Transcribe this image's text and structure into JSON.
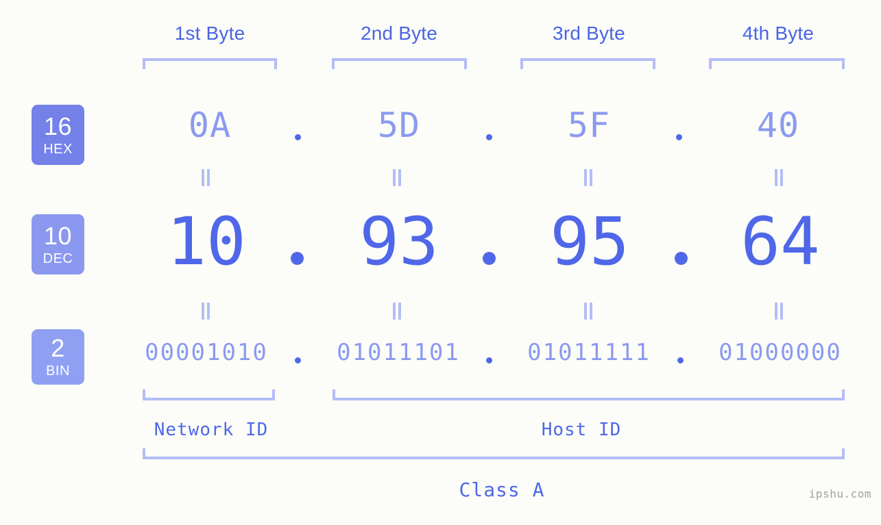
{
  "header": {
    "byte_labels": [
      "1st Byte",
      "2nd Byte",
      "3rd Byte",
      "4th Byte"
    ]
  },
  "badges": [
    {
      "num": "16",
      "sub": "HEX"
    },
    {
      "num": "10",
      "sub": "DEC"
    },
    {
      "num": "2",
      "sub": "BIN"
    }
  ],
  "rows": {
    "hex": {
      "values": [
        "0A",
        "5D",
        "5F",
        "40"
      ],
      "separator": "."
    },
    "dec": {
      "values": [
        "10",
        "93",
        "95",
        "64"
      ],
      "separator": "."
    },
    "bin": {
      "values": [
        "00001010",
        "01011101",
        "01011111",
        "01000000"
      ],
      "separator": "."
    }
  },
  "equals_marker": "=",
  "footer": {
    "network_id_label": "Network ID",
    "host_id_label": "Host ID",
    "class_label": "Class A"
  },
  "watermark": "ipshu.com",
  "colors": {
    "background": "#fcfdf9",
    "accent_strong": "#4f67e8",
    "accent_light": "#8b9aef",
    "bracket": "#b3bdf7",
    "badge_hex": "#7381e8",
    "badge_dec": "#8b98ef",
    "badge_bin": "#8fa0f3",
    "watermark": "#a0a0a0"
  }
}
